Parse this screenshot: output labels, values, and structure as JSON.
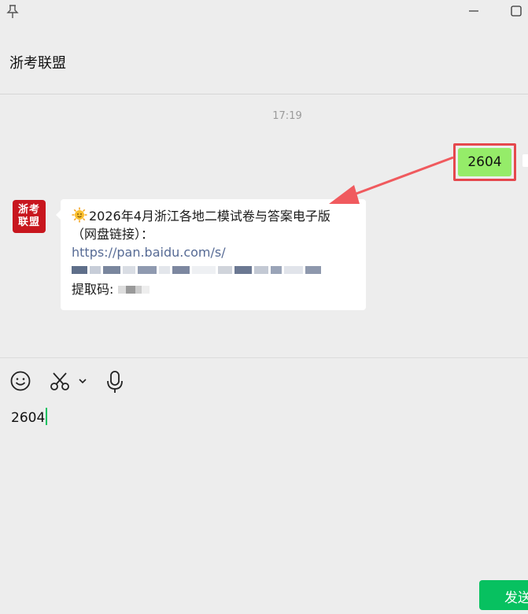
{
  "window": {
    "pin_icon": "pin-icon",
    "minimize_icon": "minimize-icon",
    "maximize_icon": "maximize-icon"
  },
  "chat": {
    "title": "浙考联盟"
  },
  "messages": {
    "timestamp": "17:19",
    "sent_text": "2604",
    "avatar_line1": "浙考",
    "avatar_line2": "联盟",
    "received": {
      "emoji_icon": "sun-emoji-icon",
      "title": "2026年4月浙江各地二模试卷与答案电子版",
      "subtitle": "（网盘链接）：",
      "link": "https://pan.baidu.com/s/",
      "code_label": "提取码:"
    }
  },
  "toolbar": {
    "emoji_icon": "emoji-icon",
    "scissors_icon": "scissors-icon",
    "chevron_icon": "chevron-down-icon",
    "mic_icon": "microphone-icon"
  },
  "composer": {
    "text": "2604"
  },
  "send_button": {
    "label": "发送"
  },
  "colors": {
    "accent_green": "#07c160",
    "sent_bubble": "#95ec69",
    "highlight_red": "#e5484d",
    "link_blue": "#576b95",
    "brand_red": "#c8161e"
  }
}
